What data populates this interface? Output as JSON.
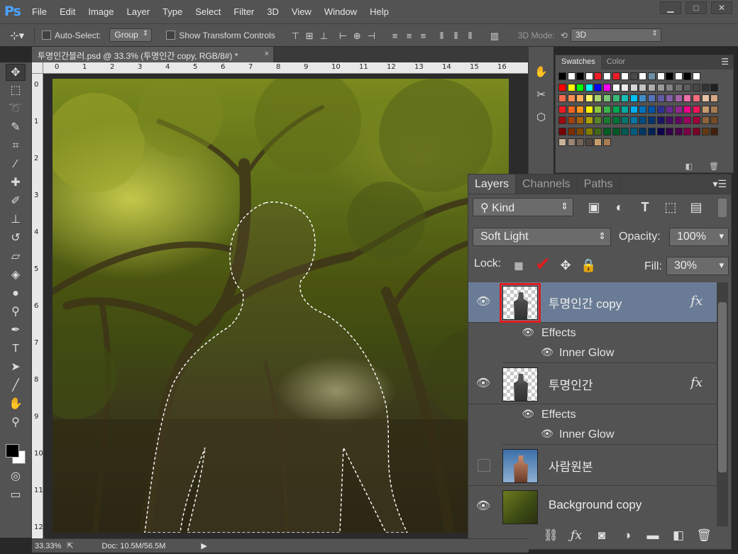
{
  "app": {
    "logo": "Ps"
  },
  "menu": [
    "File",
    "Edit",
    "Image",
    "Layer",
    "Type",
    "Select",
    "Filter",
    "3D",
    "View",
    "Window",
    "Help"
  ],
  "window_controls": [
    "▁",
    "□",
    "✕"
  ],
  "options_bar": {
    "auto_select_label": "Auto-Select:",
    "auto_select_value": "Group",
    "show_transform_label": "Show Transform Controls",
    "mode_label": "3D Mode:",
    "mode_value": "3D"
  },
  "document": {
    "tab_title": "투명인간블러.psd @ 33.3% (투명인간 copy, RGB/8#) *",
    "close": "×",
    "ruler_top": [
      "0",
      "1",
      "2",
      "3",
      "4",
      "5",
      "6",
      "7",
      "8",
      "9",
      "10",
      "11",
      "12",
      "13",
      "14",
      "15",
      "16"
    ],
    "ruler_left": [
      "0",
      "1",
      "2",
      "3",
      "4",
      "5",
      "6",
      "7",
      "8",
      "9",
      "10",
      "11",
      "12"
    ]
  },
  "status": {
    "zoom": "33.33%",
    "doc_size": "Doc: 10.5M/56.5M"
  },
  "swatches_panel": {
    "tabs": [
      "Swatches",
      "Color"
    ],
    "colors": [
      [
        "#000000",
        "#ffffff",
        "#000000",
        "#ffffff",
        "#ed1c24",
        "#ffffff",
        "#ed1c24",
        "#ffffff",
        "#4a4a4a",
        "#ffffff",
        "#6e8ea6",
        "#ffffff",
        "#000000",
        "#ffffff",
        "#000000",
        "#ffffff"
      ],
      [
        "#ff0000",
        "#ffff00",
        "#00ff00",
        "#00ffff",
        "#0000ff",
        "#ff00ff",
        "#ffffff",
        "#ebebeb",
        "#d6d6d6",
        "#c2c2c2",
        "#adadad",
        "#999999",
        "#858585",
        "#707070",
        "#5c5c5c",
        "#474747",
        "#333333",
        "#1f1f1f"
      ],
      [
        "#f26c4f",
        "#f68e55",
        "#fbaf5c",
        "#fff467",
        "#acd372",
        "#7cc576",
        "#3bb878",
        "#1abbb4",
        "#00bff3",
        "#438cca",
        "#5574b9",
        "#605ca8",
        "#855fa8",
        "#a763a8",
        "#f06ea9",
        "#f26d7d",
        "#e6c2a3",
        "#d8a785"
      ],
      [
        "#ed1c24",
        "#f26522",
        "#f7941d",
        "#fff200",
        "#8dc63f",
        "#39b54a",
        "#00a651",
        "#00a99d",
        "#00aeef",
        "#0072bc",
        "#0054a6",
        "#2e3192",
        "#662d91",
        "#92278f",
        "#ec008c",
        "#ed145b",
        "#c69c6d",
        "#a67c52"
      ],
      [
        "#9e0b0f",
        "#a0410d",
        "#a36209",
        "#aba000",
        "#598527",
        "#1a7b30",
        "#007236",
        "#00746b",
        "#0076a3",
        "#004b80",
        "#003471",
        "#1b1464",
        "#440e62",
        "#630460",
        "#9e005d",
        "#9e0039",
        "#8c6239",
        "#754c24"
      ],
      [
        "#790000",
        "#7b2e00",
        "#7d4900",
        "#827b00",
        "#406618",
        "#005e20",
        "#005826",
        "#005952",
        "#005b7f",
        "#003663",
        "#002157",
        "#0d004c",
        "#32004b",
        "#4b0049",
        "#7b0046",
        "#7a0026",
        "#603913",
        "#42210b"
      ],
      [
        "#c7b299",
        "#998675",
        "#736357",
        "#534741",
        "#c69c6d",
        "#a67c52"
      ]
    ]
  },
  "layers_panel": {
    "tabs": [
      "Layers",
      "Channels",
      "Paths"
    ],
    "kind_label": "Kind",
    "blend_mode": "Soft Light",
    "opacity_label": "Opacity:",
    "opacity_value": "100%",
    "lock_label": "Lock:",
    "fill_label": "Fill:",
    "fill_value": "30%",
    "effects_label": "Effects",
    "inner_glow_label": "Inner Glow",
    "layers": [
      {
        "name": "투명인간 copy",
        "fx": "fx",
        "visible": true,
        "selected": true
      },
      {
        "name": "투명인간",
        "fx": "fx",
        "visible": true,
        "selected": false
      },
      {
        "name": "사람원본",
        "fx": "",
        "visible": false,
        "selected": false
      },
      {
        "name": "Background copy",
        "fx": "",
        "visible": true,
        "selected": false
      }
    ]
  }
}
